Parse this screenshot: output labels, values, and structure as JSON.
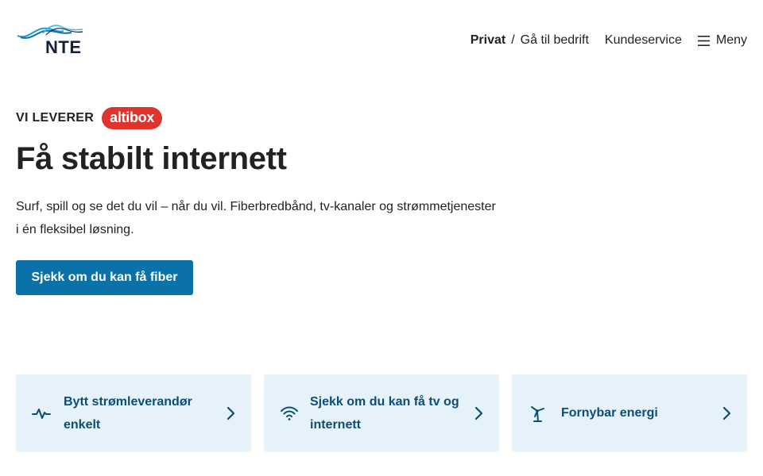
{
  "header": {
    "logo_text": "NTE",
    "nav": {
      "privat": "Privat",
      "slash": "/",
      "bedrift": "Gå til bedrift",
      "kundeservice": "Kundeservice",
      "menu": "Meny"
    }
  },
  "hero": {
    "eyebrow": "VI LEVERER",
    "badge": "altibox",
    "title": "Få stabilt internett",
    "lead_line1": "Surf, spill og se det du vil – når du vil. Fiberbredbånd, tv-kanaler og strømmetjenester",
    "lead_line2": "i én fleksibel løsning.",
    "cta": "Sjekk om du kan få fiber"
  },
  "cards": [
    {
      "icon": "pulse-icon",
      "line1": "Bytt strømleverandør",
      "line2": "enkelt"
    },
    {
      "icon": "wifi-icon",
      "line1": "Sjekk om du kan få tv og",
      "line2": "internett"
    },
    {
      "icon": "wind-turbine-icon",
      "line1": "Fornybar energi",
      "line2": ""
    }
  ],
  "colors": {
    "primary": "#0a72a8",
    "card_bg": "#e6f2f9",
    "card_text": "#0b4e75",
    "altibox": "#e0332b"
  }
}
